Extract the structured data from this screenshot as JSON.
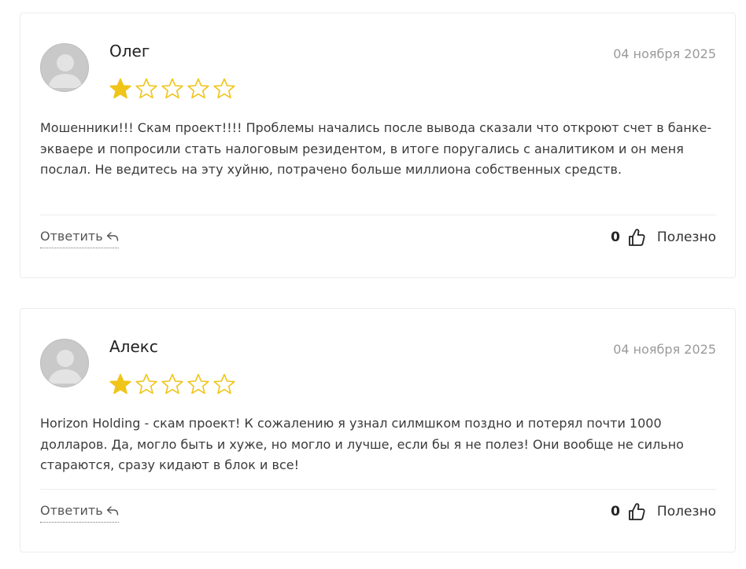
{
  "colors": {
    "star_filled": "#f0c419",
    "star_empty_stroke": "#f0c419",
    "avatar_bg": "#c9c9c9",
    "date": "#9a9a9a"
  },
  "reviews": [
    {
      "author": "Олег",
      "date": "04 ноября 2025",
      "rating": 1,
      "max_rating": 5,
      "text": "Мошенники!!! Скам проект!!!! Проблемы начались после вывода сказали что откроют счет в банке-экваере и попросили стать налоговым резидентом, в итоге поругались с аналитиком и он меня послал. Не ведитесь на эту хуйню, потрачено больше миллиона собственных средств.",
      "reply_label": "Ответить",
      "likes": "0",
      "helpful_label": "Полезно",
      "avatar_icon": "default-user-avatar"
    },
    {
      "author": "Алекс",
      "date": "04 ноября 2025",
      "rating": 1,
      "max_rating": 5,
      "text": "Horizon Holding - скам проект! К сожалению я узнал силмшком поздно и потерял почти 1000 долларов. Да, могло быть и хуже, но могло и лучше, если бы я не полез! Они вообще не сильно стараются, сразу кидают в блок и все!",
      "reply_label": "Ответить",
      "likes": "0",
      "helpful_label": "Полезно",
      "avatar_icon": "default-user-avatar"
    }
  ]
}
